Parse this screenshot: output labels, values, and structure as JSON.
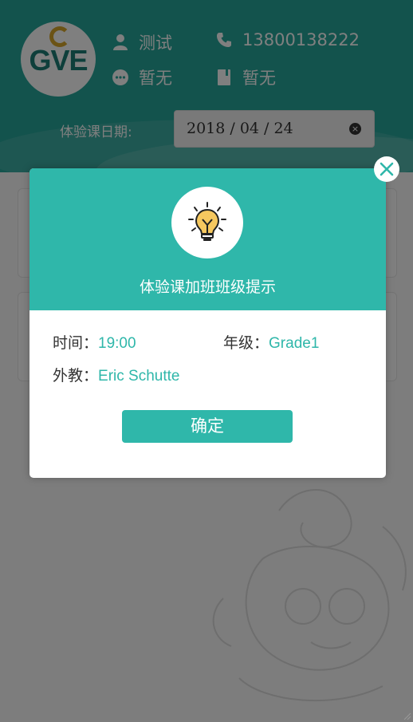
{
  "header": {
    "logo_text": "GVE",
    "name": "测试",
    "phone": "13800138222",
    "note": "暂无",
    "book": "暂无",
    "icons": {
      "name": "user-icon",
      "phone": "phone-icon",
      "note": "chat-dots-icon",
      "book": "book-icon"
    }
  },
  "date_filter": {
    "label": "体验课日期:",
    "value": "2018 / 04 / 24",
    "clear_glyph": "×"
  },
  "dialog": {
    "icon": "lightbulb-icon",
    "title": "体验课加班班级提示",
    "time_label": "时间：",
    "time_value": "19:00",
    "grade_label": "年级：",
    "grade_value": "Grade1",
    "teacher_label": "外教：",
    "teacher_value": "Eric Schutte",
    "confirm_label": "确定",
    "close_icon": "close-icon"
  },
  "colors": {
    "header": "#27a69a",
    "accent": "#2fb7aa",
    "overlay": "rgba(0,0,0,0.5)"
  }
}
